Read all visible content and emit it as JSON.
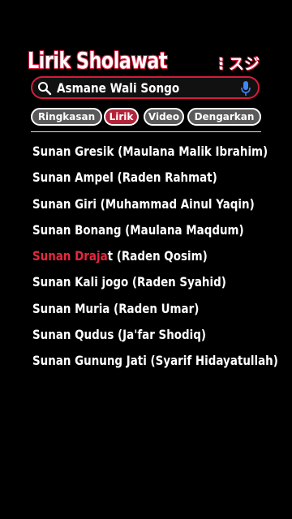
{
  "app": {
    "title": "Lirik Sholawat",
    "menu_glyph": "⋮スジ"
  },
  "search": {
    "value": "Asmane Wali Songo"
  },
  "tabs": [
    {
      "label": "Ringkasan",
      "active": false
    },
    {
      "label": "Lirik",
      "active": true
    },
    {
      "label": "Video",
      "active": false
    },
    {
      "label": "Dengarkan",
      "active": false
    }
  ],
  "lyrics": [
    {
      "text": "Sunan Gresik (Maulana Malik Ibrahim)"
    },
    {
      "text": "Sunan Ampel (Raden Rahmat)"
    },
    {
      "text": "Sunan Giri (Muhammad Ainul Yaqin)"
    },
    {
      "text": "Sunan Bonang (Maulana Maqdum)"
    },
    {
      "highlight": "Sunan Draja",
      "rest": "t (Raden Qosim)"
    },
    {
      "text": "Sunan Kali jogo (Raden Syahid)"
    },
    {
      "text": "Sunan Muria (Raden Umar)"
    },
    {
      "text": "Sunan Qudus (Ja'far Shodiq)"
    },
    {
      "text": "Sunan Gunung Jati (Syarif Hidayatullah)"
    }
  ],
  "colors": {
    "accent": "#d81b3c",
    "highlight": "#e5283f",
    "active_tab": "#b3243a"
  }
}
